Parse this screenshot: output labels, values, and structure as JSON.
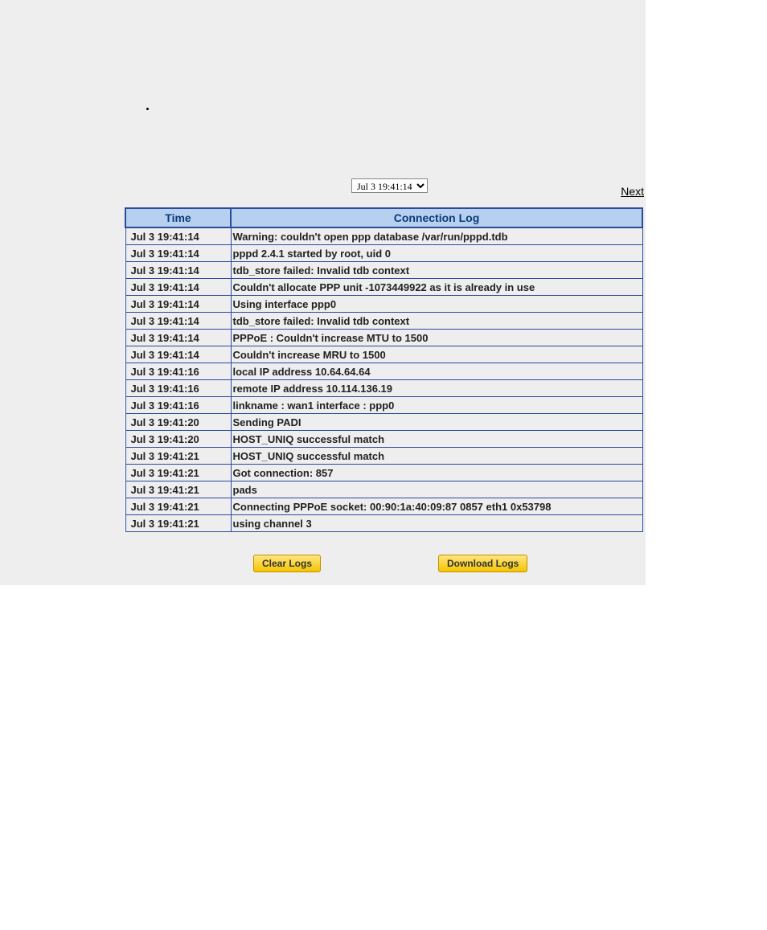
{
  "topbar": {
    "time_select_value": "Jul 3 19:41:14",
    "next_label": "Next"
  },
  "table": {
    "header_time": "Time",
    "header_log": "Connection Log",
    "rows": [
      {
        "time": "Jul 3 19:41:14",
        "msg": "Warning: couldn't open ppp database /var/run/pppd.tdb"
      },
      {
        "time": "Jul 3 19:41:14",
        "msg": "pppd 2.4.1 started by root, uid 0"
      },
      {
        "time": "Jul 3 19:41:14",
        "msg": "tdb_store failed: Invalid tdb context"
      },
      {
        "time": "Jul 3 19:41:14",
        "msg": "Couldn't allocate PPP unit -1073449922 as it is already in use"
      },
      {
        "time": "Jul 3 19:41:14",
        "msg": "Using interface ppp0"
      },
      {
        "time": "Jul 3 19:41:14",
        "msg": "tdb_store failed: Invalid tdb context"
      },
      {
        "time": "Jul 3 19:41:14",
        "msg": "PPPoE : Couldn't increase MTU to 1500"
      },
      {
        "time": "Jul 3 19:41:14",
        "msg": "Couldn't increase MRU to 1500"
      },
      {
        "time": "Jul 3 19:41:16",
        "msg": "local IP address 10.64.64.64"
      },
      {
        "time": "Jul 3 19:41:16",
        "msg": "remote IP address 10.114.136.19"
      },
      {
        "time": "Jul 3 19:41:16",
        "msg": "linkname : wan1 interface : ppp0"
      },
      {
        "time": "Jul 3 19:41:20",
        "msg": "Sending PADI"
      },
      {
        "time": "Jul 3 19:41:20",
        "msg": "HOST_UNIQ successful match"
      },
      {
        "time": "Jul 3 19:41:21",
        "msg": "HOST_UNIQ successful match"
      },
      {
        "time": "Jul 3 19:41:21",
        "msg": "Got connection: 857"
      },
      {
        "time": "Jul 3 19:41:21",
        "msg": "pads"
      },
      {
        "time": "Jul 3 19:41:21",
        "msg": "Connecting PPPoE socket: 00:90:1a:40:09:87 0857 eth1 0x53798"
      },
      {
        "time": "Jul 3 19:41:21",
        "msg": "using channel 3"
      }
    ]
  },
  "buttons": {
    "clear_label": "Clear Logs",
    "download_label": "Download Logs"
  }
}
